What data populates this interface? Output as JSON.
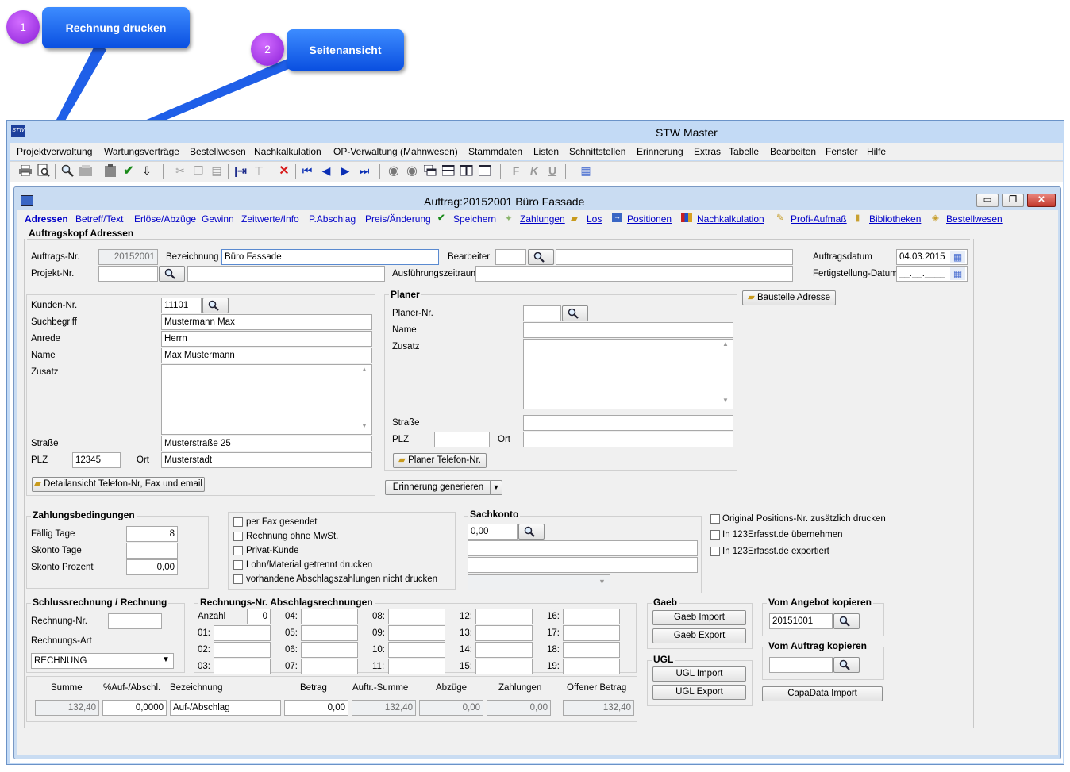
{
  "callouts": [
    {
      "num": "1",
      "label": "Rechnung drucken"
    },
    {
      "num": "2",
      "label": "Seitenansicht"
    }
  ],
  "app": {
    "title": "STW Master",
    "logo": "STW"
  },
  "menu": [
    "Projektverwaltung",
    "Wartungsverträge",
    "Bestellwesen",
    "Nachkalkulation",
    "OP-Verwaltung (Mahnwesen)",
    "Stammdaten",
    "Listen",
    "Schnittstellen",
    "Erinnerung",
    "Extras",
    "Tabelle",
    "Bearbeiten",
    "Fenster",
    "Hilfe"
  ],
  "toolbar": {
    "icons": [
      "print-icon",
      "preview-icon",
      "search-icon",
      "card-icon",
      "clipboard-icon",
      "check-icon",
      "import-icon",
      "cut-icon",
      "copy-icon",
      "paste-icon",
      "insert-col-icon",
      "insert-row-icon",
      "delete-icon",
      "first-icon",
      "prev-icon",
      "next-icon",
      "last-icon",
      "back-icon",
      "forward-icon",
      "cascade-icon",
      "split-h-icon",
      "split-v-icon",
      "window-icon",
      "bold-icon",
      "italic-icon",
      "underline-icon",
      "grid-icon"
    ],
    "b": "F",
    "i": "K",
    "u": "U"
  },
  "window": {
    "title": "Auftrag:20152001 Büro Fassade"
  },
  "nav": {
    "items": [
      "Adressen",
      "Betreff/Text",
      "Erlöse/Abzüge",
      "Gewinn",
      "Zeitwerte/Info",
      "P.Abschlag",
      "Preis/Änderung",
      "Speichern",
      "Zahlungen",
      "Los",
      "Positionen",
      "Nachkalkulation",
      "Profi-Aufmaß",
      "Bibliotheken",
      "Bestellwesen"
    ]
  },
  "head": {
    "section": "Auftragskopf Adressen",
    "auftrag_nr_label": "Auftrags-Nr.",
    "auftrag_nr": "20152001",
    "bezeichnung_label": "Bezeichnung",
    "bezeichnung": "Büro Fassade",
    "bearbeiter_label": "Bearbeiter",
    "bearbeiter": "",
    "auftragsdatum_label": "Auftragsdatum",
    "auftragsdatum": "04.03.2015",
    "projekt_nr_label": "Projekt-Nr.",
    "projekt_nr": "",
    "ausfuehrung_label": "Ausführungszeitraum",
    "ausfuehrung": "",
    "fertig_label": "Fertigstellung-Datum",
    "fertig": "__.__.____"
  },
  "kunde": {
    "kunden_nr_label": "Kunden-Nr.",
    "kunden_nr": "11101",
    "suchbegriff_label": "Suchbegriff",
    "suchbegriff": "Mustermann Max",
    "anrede_label": "Anrede",
    "anrede": "Herrn",
    "name_label": "Name",
    "name": "Max Mustermann",
    "zusatz_label": "Zusatz",
    "zusatz": "",
    "strasse_label": "Straße",
    "strasse": "Musterstraße 25",
    "plz_label": "PLZ",
    "plz": "12345",
    "ort_label": "Ort",
    "ort": "Musterstadt",
    "detail_button": "Detailansicht Telefon-Nr, Fax und email"
  },
  "planer": {
    "title": "Planer",
    "planer_nr_label": "Planer-Nr.",
    "name_label": "Name",
    "zusatz_label": "Zusatz",
    "strasse_label": "Straße",
    "plz_label": "PLZ",
    "ort_label": "Ort",
    "telefon_button": "Planer Telefon-Nr.",
    "baustelle_button": "Baustelle Adresse"
  },
  "erinnerung_button": "Erinnerung generieren",
  "zahlung": {
    "title": "Zahlungsbedingungen",
    "faellig_label": "Fällig Tage",
    "faellig": "8",
    "skonto_tage_label": "Skonto Tage",
    "skonto_tage": "",
    "skonto_prozent_label": "Skonto Prozent",
    "skonto_prozent": "0,00"
  },
  "checks": [
    "per Fax gesendet",
    "Rechnung ohne MwSt.",
    "Privat-Kunde",
    "Lohn/Material getrennt drucken",
    "vorhandene Abschlagszahlungen nicht drucken"
  ],
  "sachkonto": {
    "title": "Sachkonto",
    "value": "0,00"
  },
  "options": [
    "Original Positions-Nr. zusätzlich drucken",
    "In 123Erfasst.de übernehmen",
    "In 123Erfasst.de exportiert"
  ],
  "schluss": {
    "title": "Schlussrechnung / Rechnung",
    "rechnung_nr_label": "Rechnung-Nr.",
    "rechnung_nr": "",
    "art_label": "Rechnungs-Art",
    "art": "RECHNUNG"
  },
  "abschlag": {
    "title": "Rechnungs-Nr. Abschlagsrechnungen",
    "anzahl_label": "Anzahl",
    "anzahl": "0",
    "labels": [
      "01:",
      "02:",
      "03:",
      "04:",
      "05:",
      "06:",
      "07:",
      "08:",
      "09:",
      "10:",
      "11:",
      "12:",
      "13:",
      "14:",
      "15:",
      "16:",
      "17:",
      "18:",
      "19:"
    ]
  },
  "summary": {
    "headers": [
      "Summe",
      "%Auf-/Abschl.",
      "Bezeichnung",
      "Betrag",
      "Auftr.-Summe",
      "Abzüge",
      "Zahlungen",
      "Offener Betrag"
    ],
    "values": [
      "132,40",
      "0,0000",
      "Auf-/Abschlag",
      "0,00",
      "132,40",
      "0,00",
      "0,00",
      "132,40"
    ]
  },
  "gaeb": {
    "title": "Gaeb",
    "import": "Gaeb Import",
    "export": "Gaeb Export"
  },
  "ugl": {
    "title": "UGL",
    "import": "UGL Import",
    "export": "UGL Export"
  },
  "angebot": {
    "title": "Vom Angebot kopieren",
    "value": "20151001"
  },
  "vomauftrag": {
    "title": "Vom Auftrag kopieren",
    "value": ""
  },
  "capadata": "CapaData Import",
  "colors": {
    "accent": "#0000c8",
    "window_bg": "#f0f0f0",
    "title_blue": "#c9dcf2",
    "callout": "#1a63f0",
    "circle": "#a63cf0"
  }
}
